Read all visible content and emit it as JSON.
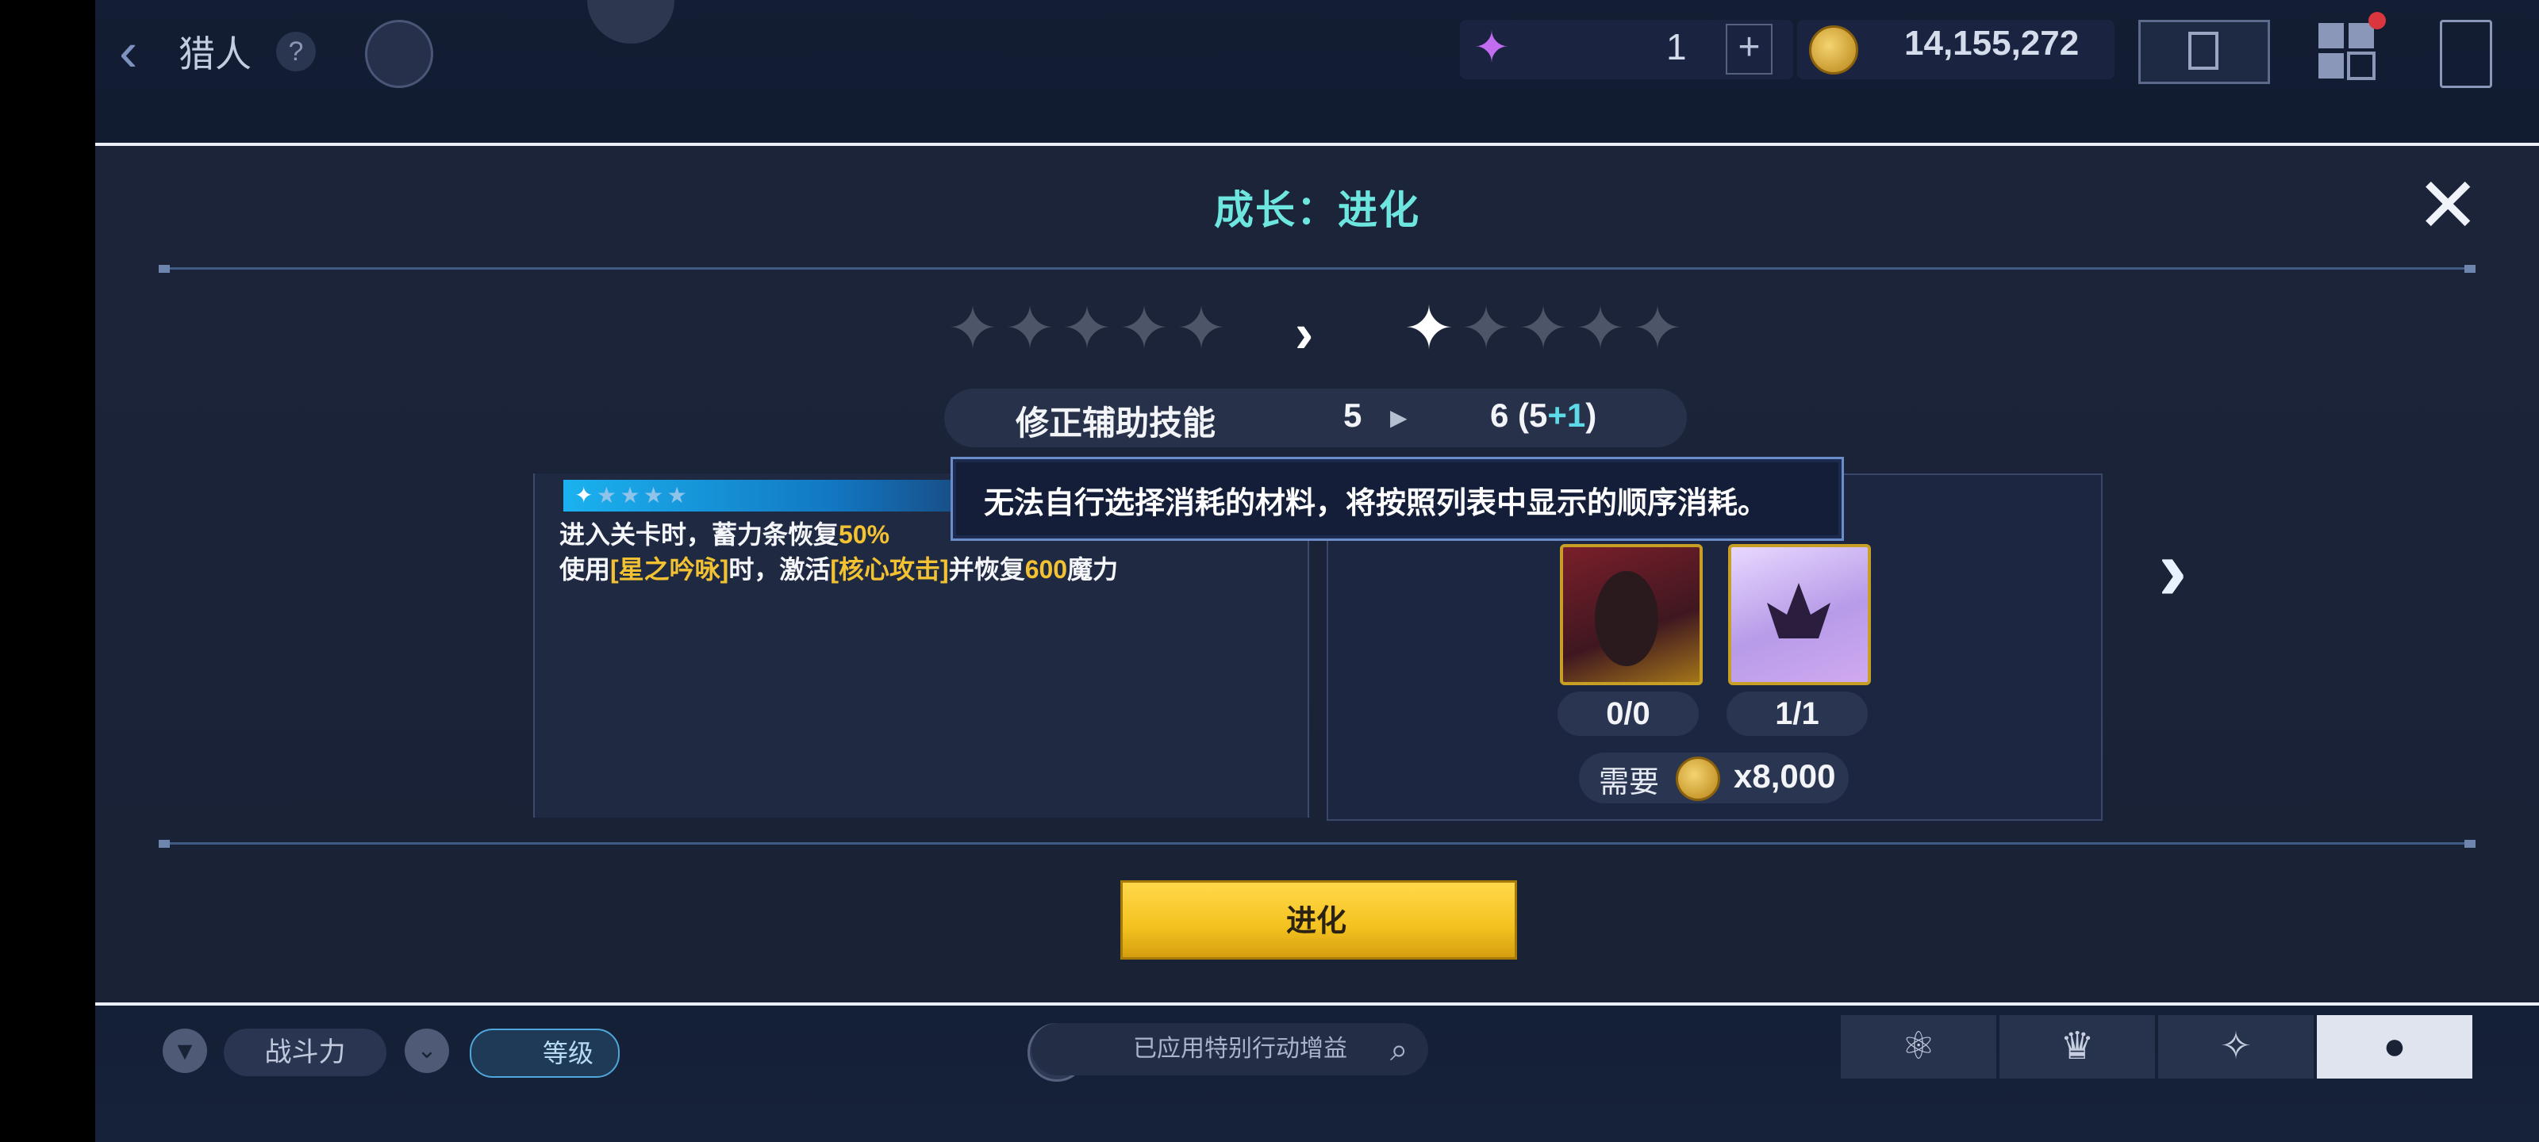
{
  "topbar": {
    "title": "猎人",
    "help": "?",
    "gem_count": "1",
    "gem_plus": "+",
    "gold": "14,155,272"
  },
  "dialog": {
    "title": "成长：进化",
    "close": "✕",
    "stars_before": 0,
    "stars_after": 1,
    "stars_total": 5,
    "skill": {
      "label": "修正辅助技能",
      "from": "5",
      "to_prefix": "6 (5",
      "to_plus": "+1",
      "to_suffix": ")"
    },
    "tooltip": "无法自行选择消耗的材料，将按照列表中显示的顺序消耗。",
    "description": {
      "line1_a": "进入关卡时，蓄力条恢复",
      "line1_hl": "50%",
      "line2_a": "使用",
      "line2_hl1": "[星之吟咏]",
      "line2_b": "时，激活",
      "line2_hl2": "[核心攻击]",
      "line2_c": "并恢复",
      "line2_hl3": "600",
      "line2_d": "魔力"
    },
    "materials": [
      {
        "count": "0/0"
      },
      {
        "count": "1/1"
      }
    ],
    "need_label": "需要",
    "need_value": "x8,000",
    "evolve_button": "进化"
  },
  "bottombar": {
    "power_label": "战斗力",
    "level_label": "等级",
    "search_text": "已应用特别行动增益"
  },
  "colors": {
    "title_accent": "#6ee6e0",
    "highlight": "#f2c232",
    "plus": "#5ed9e8",
    "button": "#f4c21f"
  }
}
